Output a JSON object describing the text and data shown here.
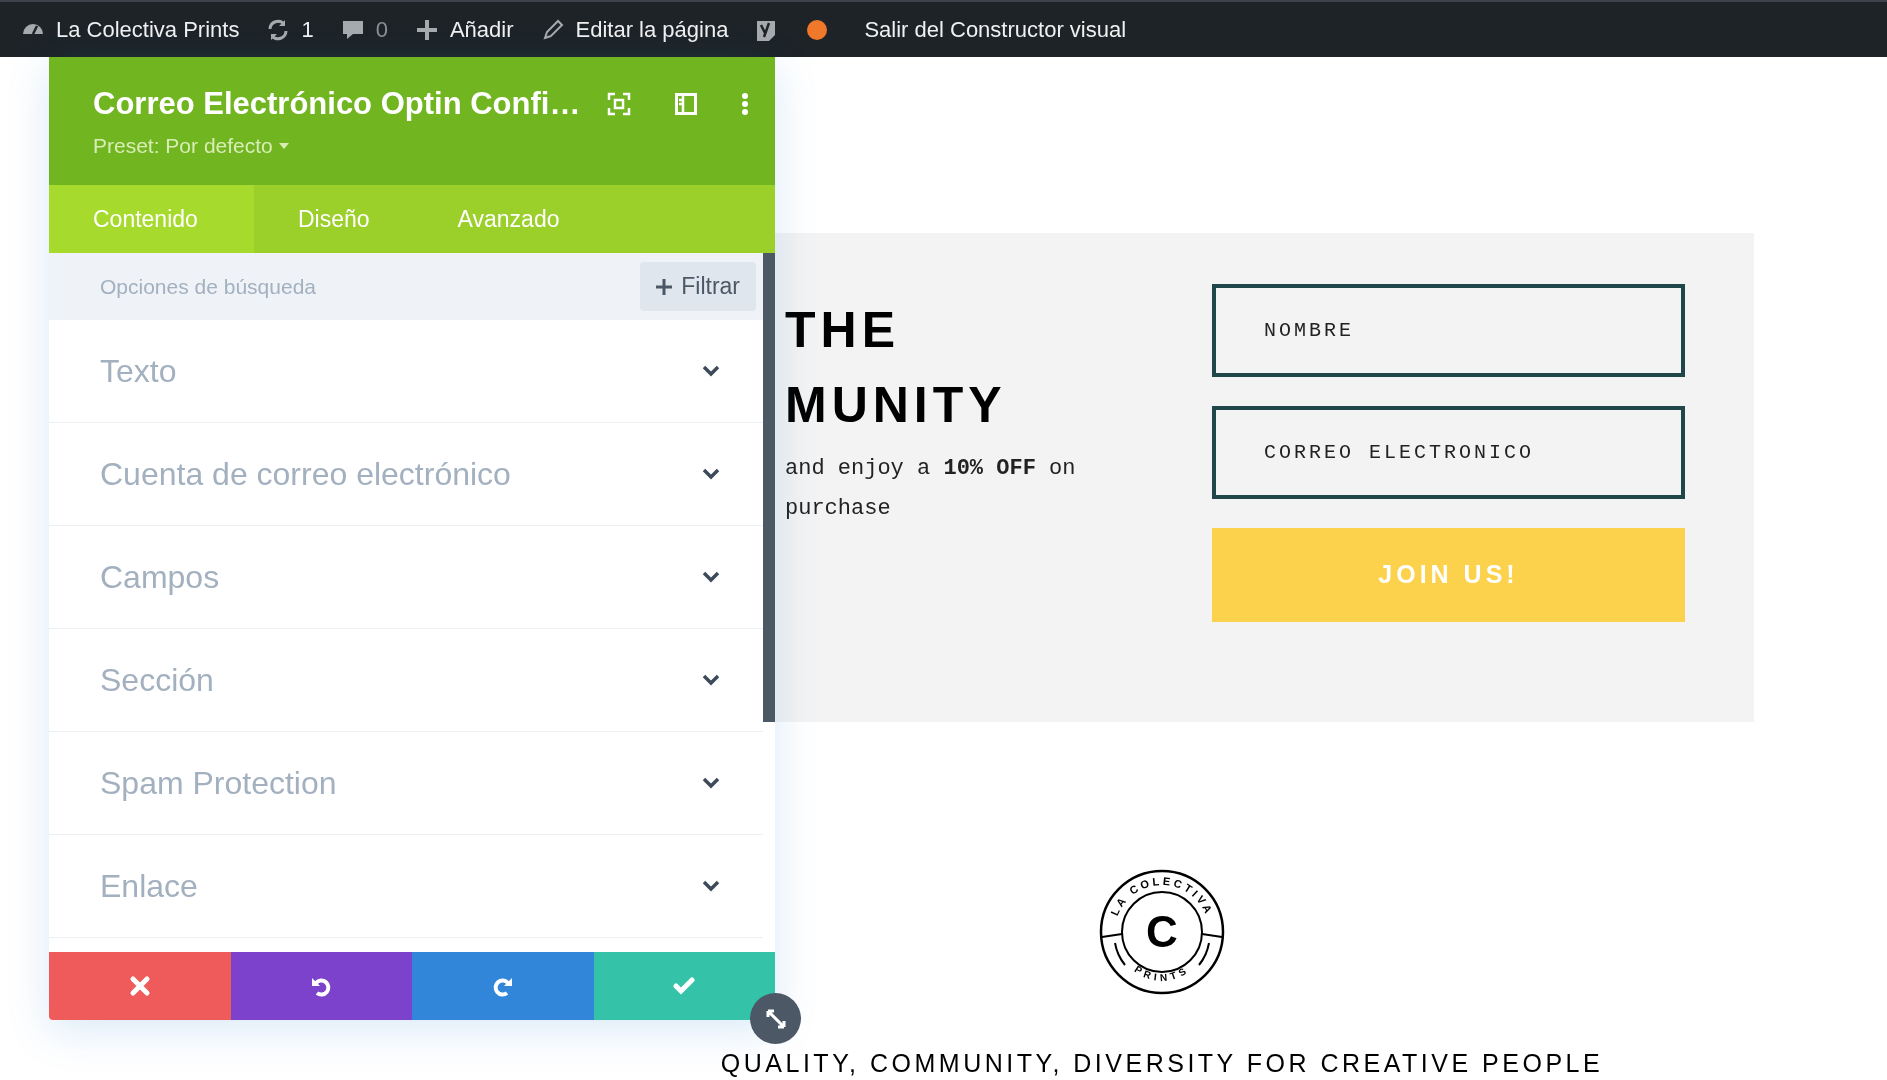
{
  "admin_bar": {
    "items": [
      {
        "kind": "site",
        "label": "La Colectiva Prints"
      },
      {
        "kind": "updates",
        "label": "1"
      },
      {
        "kind": "comments",
        "label": "0"
      },
      {
        "kind": "new",
        "label": "Añadir"
      },
      {
        "kind": "edit",
        "label": "Editar la página"
      },
      {
        "kind": "seo"
      },
      {
        "kind": "status"
      },
      {
        "kind": "exit",
        "label": "Salir del Constructor visual"
      }
    ]
  },
  "settings_panel": {
    "title": "Correo Electrónico Optin Confi…",
    "preset": "Preset: Por defecto",
    "tabs": [
      {
        "label": "Contenido",
        "selected": true
      },
      {
        "label": "Diseño",
        "selected": false
      },
      {
        "label": "Avanzado",
        "selected": false
      }
    ],
    "search": {
      "placeholder": "Opciones de búsqueda"
    },
    "filter_button": "Filtrar",
    "sections": [
      {
        "label": "Texto",
        "expanded": false
      },
      {
        "label": "Cuenta de correo electrónico",
        "expanded": false
      },
      {
        "label": "Campos",
        "expanded": false
      },
      {
        "label": "Sección",
        "expanded": false
      },
      {
        "label": "Spam Protection",
        "expanded": false
      },
      {
        "label": "Enlace",
        "expanded": false
      }
    ],
    "actions": [
      {
        "kind": "discard"
      },
      {
        "kind": "undo"
      },
      {
        "kind": "redo"
      },
      {
        "kind": "save"
      }
    ]
  },
  "page": {
    "heading_lines": [
      "THE",
      "MUNITY"
    ],
    "promo": "and enjoy a **10% OFF** on purchase",
    "fields": [
      {
        "placeholder": "NOMBRE"
      },
      {
        "placeholder": "CORREO ELECTRONICO"
      }
    ],
    "submit": "JOIN US!",
    "logo": {
      "top": "LA COLECTIVA",
      "center": "C",
      "bottom": "PRINTS"
    },
    "tagline": "QUALITY, COMMUNITY, DIVERSITY FOR CREATIVE PEOPLE"
  }
}
